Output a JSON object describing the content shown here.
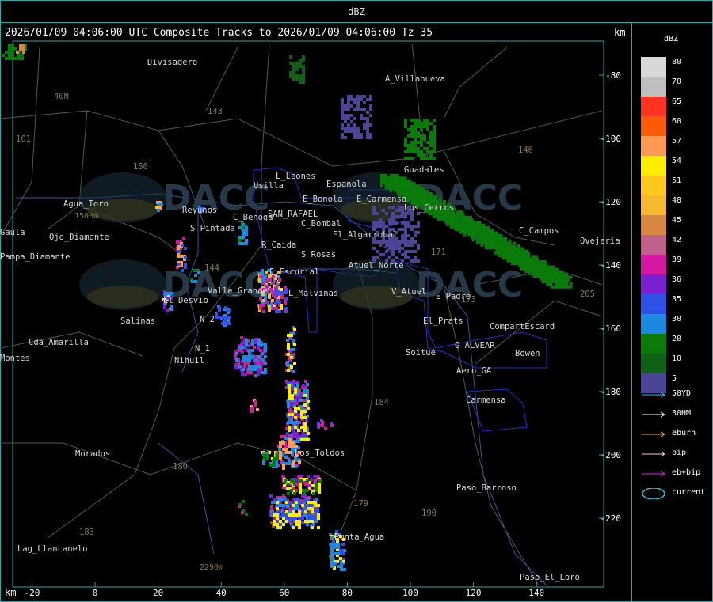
{
  "header": {
    "title": "dBZ"
  },
  "map": {
    "title": "2026/01/09 04:06:00 UTC Composite Tracks to 2026/01/09 04:06:00 Tz 35",
    "km_unit": "km",
    "x_ticks": [
      "-20",
      "0",
      "20",
      "40",
      "60",
      "80",
      "100",
      "120",
      "140"
    ],
    "y_ticks": [
      "-80",
      "-100",
      "-120",
      "-140",
      "-160",
      "-180",
      "-200",
      "-220"
    ],
    "places": [
      "Divisadero",
      "A_Villanueva",
      "Guadales",
      "L_Leones",
      "Espanola",
      "Usilla",
      "E_Bonola",
      "E_Carmensa",
      "Los_Cerros",
      "Agua_Toro",
      "Reyunos",
      "S_Pintada",
      "C_Benoga",
      "SAN_RAFAEL",
      "C_Bombal",
      "El_Algarrobal",
      "C_Campos",
      "Ovejeria",
      "Pampa_Diamante",
      "R_Caida",
      "S_Rosas",
      "Atuel_Norte",
      "E_Escurial",
      "Valle_Grande",
      "L_Malvinas",
      "V_Atuel",
      "E_Padre",
      "El_Desvio",
      "Salinas",
      "N_2",
      "El_Prats",
      "CompartEscard",
      "Cda_Amarilla",
      "N_1",
      "Nihuil",
      "G_ALVEAR",
      "Bowen",
      "Soitue",
      "Aero_GA",
      "Carmensa",
      "Morados",
      "Los_Toldos",
      "Paso_Barroso",
      "Punta_Agua",
      "Lag_Llancanelo",
      "Paso_El_Loro",
      "Montes",
      "Gaula",
      "Ojo_Diamante"
    ],
    "route_numbers": [
      "143",
      "146",
      "150",
      "101",
      "40N",
      "184",
      "179",
      "183",
      "180",
      "190",
      "171",
      "173",
      "205",
      "144"
    ],
    "elevation_labels": [
      "1500m",
      "2290m"
    ],
    "watermark": "DACC"
  },
  "legend": {
    "unit": "dBZ",
    "colors": [
      {
        "label": "80",
        "color": "#d8d8d8"
      },
      {
        "label": "70",
        "color": "#bfbfbf"
      },
      {
        "label": "65",
        "color": "#ff3322"
      },
      {
        "label": "60",
        "color": "#ff5a08"
      },
      {
        "label": "57",
        "color": "#ff9a55"
      },
      {
        "label": "54",
        "color": "#ffee00"
      },
      {
        "label": "51",
        "color": "#ffc81e"
      },
      {
        "label": "48",
        "color": "#f6b830"
      },
      {
        "label": "45",
        "color": "#d88840"
      },
      {
        "label": "42",
        "color": "#c0608c"
      },
      {
        "label": "39",
        "color": "#d418a0"
      },
      {
        "label": "36",
        "color": "#7a20d0"
      },
      {
        "label": "35",
        "color": "#2e52e8"
      },
      {
        "label": "30",
        "color": "#1c88e0"
      },
      {
        "label": "20",
        "color": "#0a7a0a"
      },
      {
        "label": "10",
        "color": "#106016"
      },
      {
        "label": "5",
        "color": "#4c4496"
      }
    ],
    "tracks": [
      {
        "label": "50YD",
        "color": "#1ec8e0"
      },
      {
        "label": "30HM",
        "color": "#ffffff"
      },
      {
        "label": "eburn",
        "color": "#ffb030"
      },
      {
        "label": "bip",
        "color": "#ffc0d8"
      },
      {
        "label": "eb+bip",
        "color": "#e020e0"
      },
      {
        "label": "current",
        "color": "#1ec8e0"
      }
    ]
  }
}
